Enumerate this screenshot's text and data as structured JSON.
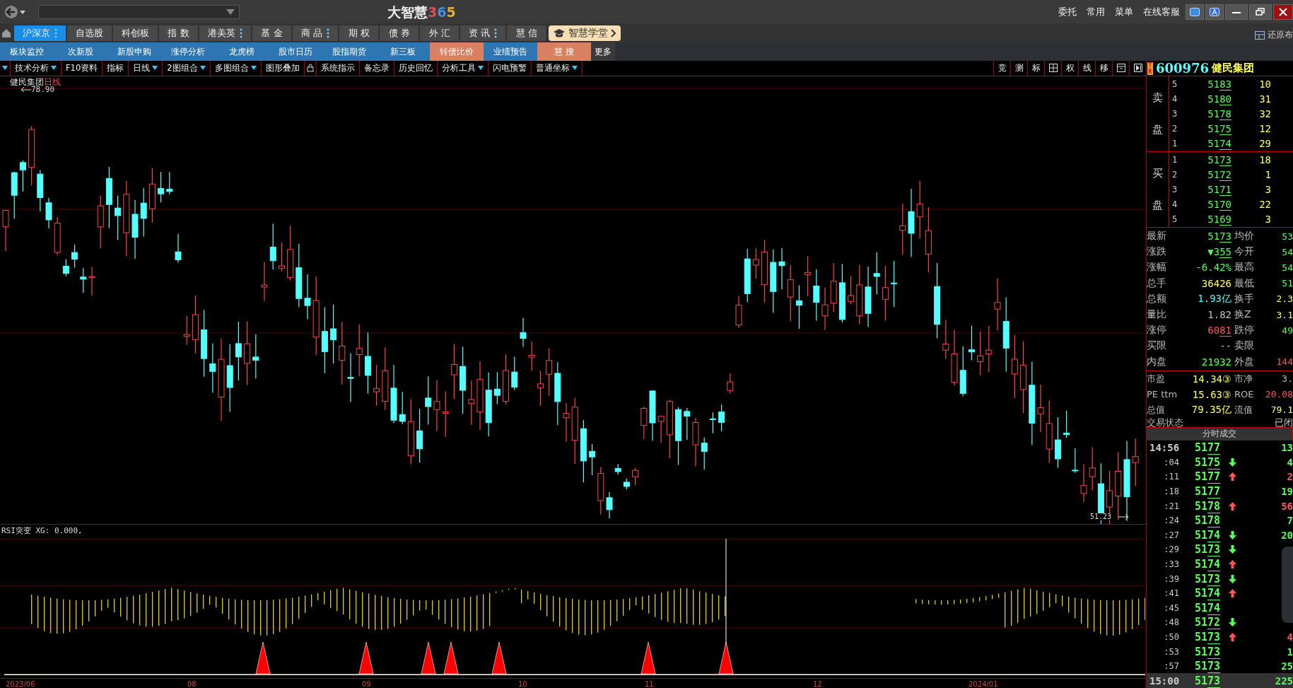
{
  "title_bar": {
    "title": "大智慧",
    "title_suffix": "365",
    "links": [
      "委托",
      "常用",
      "菜单",
      "在线客服"
    ]
  },
  "main_tabs": [
    {
      "label": "沪深京",
      "selected": true,
      "menu": true
    },
    {
      "label": "自选股",
      "selected": false,
      "menu": false
    },
    {
      "label": "科创板",
      "selected": false,
      "menu": false
    },
    {
      "label": "指 数",
      "selected": false,
      "menu": false
    },
    {
      "label": "港美英",
      "selected": false,
      "menu": true
    },
    {
      "label": "基 金",
      "selected": false,
      "menu": false
    },
    {
      "label": "商 品",
      "selected": false,
      "menu": true
    },
    {
      "label": "期 权",
      "selected": false,
      "menu": false
    },
    {
      "label": "债 券",
      "selected": false,
      "menu": false
    },
    {
      "label": "外 汇",
      "selected": false,
      "menu": false
    },
    {
      "label": "资 讯",
      "selected": false,
      "menu": true
    },
    {
      "label": "慧 信",
      "selected": false,
      "menu": false
    }
  ],
  "academy_button": "智慧学堂",
  "restore_layout": "还原布",
  "sub_tabs": [
    {
      "label": "板块监控",
      "kind": "plain"
    },
    {
      "label": "次新股",
      "kind": "plain"
    },
    {
      "label": "新股申购",
      "kind": "plain"
    },
    {
      "label": "涨停分析",
      "kind": "plain"
    },
    {
      "label": "龙虎榜",
      "kind": "plain"
    },
    {
      "label": "股市日历",
      "kind": "plain"
    },
    {
      "label": "股指期货",
      "kind": "plain"
    },
    {
      "label": "新三板",
      "kind": "plain"
    },
    {
      "label": "转债比价",
      "kind": "orange"
    },
    {
      "label": "业绩预告",
      "kind": "blue"
    },
    {
      "label": "慧 搜",
      "kind": "orange"
    },
    {
      "label": "更多",
      "kind": "dark"
    }
  ],
  "toolbar": [
    {
      "kind": "caret"
    },
    {
      "kind": "text",
      "label": "技术分析",
      "dropdown": true
    },
    {
      "kind": "text",
      "label": "F10资料",
      "dropdown": false
    },
    {
      "kind": "text",
      "label": "指标",
      "dropdown": false
    },
    {
      "kind": "text",
      "label": "日线",
      "dropdown": true
    },
    {
      "kind": "text",
      "label": "2图组合",
      "dropdown": true
    },
    {
      "kind": "text",
      "label": "多图组合",
      "dropdown": true
    },
    {
      "kind": "text",
      "label": "图形叠加",
      "dropdown": false
    },
    {
      "kind": "lock"
    },
    {
      "kind": "text",
      "label": "系统指示",
      "dropdown": false
    },
    {
      "kind": "text",
      "label": "备忘录",
      "dropdown": false
    },
    {
      "kind": "text",
      "label": "历史回忆",
      "dropdown": false
    },
    {
      "kind": "text",
      "label": "分析工具",
      "dropdown": true
    },
    {
      "kind": "text",
      "label": "闪电预警",
      "dropdown": false
    },
    {
      "kind": "text",
      "label": "普通坐标",
      "dropdown": true
    }
  ],
  "chart_tools": [
    {
      "kind": "text",
      "label": "竞"
    },
    {
      "kind": "text",
      "label": "测"
    },
    {
      "kind": "text",
      "label": "标"
    },
    {
      "kind": "grid"
    },
    {
      "kind": "text",
      "label": "权"
    },
    {
      "kind": "text",
      "label": "线"
    },
    {
      "kind": "text",
      "label": "移"
    },
    {
      "kind": "panel"
    },
    {
      "kind": "play"
    }
  ],
  "chart": {
    "name": "健民集团",
    "period": "日线",
    "high_label": "78.90",
    "low_label": "51.23",
    "x_labels": [
      "2023/06",
      "08",
      "09",
      "10",
      "11",
      "12",
      "2024/01"
    ]
  },
  "indicator": {
    "label": "RSI突变 XG: 0.000,"
  },
  "stock": {
    "badge": "TR",
    "code": "600976",
    "name": "健民集团"
  },
  "order_book": {
    "sell_label": "卖盘",
    "buy_label": "买盘",
    "sells": [
      {
        "level": "5",
        "price": "5183",
        "volume": "10"
      },
      {
        "level": "4",
        "price": "5180",
        "volume": "31"
      },
      {
        "level": "3",
        "price": "5178",
        "volume": "32"
      },
      {
        "level": "2",
        "price": "5175",
        "volume": "12"
      },
      {
        "level": "1",
        "price": "5174",
        "volume": "29"
      }
    ],
    "buys": [
      {
        "level": "1",
        "price": "5173",
        "volume": "18"
      },
      {
        "level": "2",
        "price": "5172",
        "volume": "1"
      },
      {
        "level": "3",
        "price": "5171",
        "volume": "3"
      },
      {
        "level": "4",
        "price": "5170",
        "volume": "22"
      },
      {
        "level": "5",
        "price": "5169",
        "volume": "3"
      }
    ]
  },
  "stats": [
    {
      "left": {
        "label": "最新",
        "value": "5173",
        "color": "#55ff55",
        "underline": true
      },
      "right": {
        "label": "均价",
        "value": "53",
        "color": "#55ff55"
      }
    },
    {
      "left": {
        "label": "涨跌",
        "value": "▼355",
        "color": "#55ff55",
        "underline": true
      },
      "right": {
        "label": "今开",
        "value": "54",
        "color": "#55ff55"
      }
    },
    {
      "left": {
        "label": "涨幅",
        "value": "-6.42%",
        "color": "#55ff55",
        "underline": false
      },
      "right": {
        "label": "最高",
        "value": "54",
        "color": "#55ff55"
      }
    },
    {
      "left": {
        "label": "总手",
        "value": "36426",
        "color": "#ffff55",
        "underline": false
      },
      "right": {
        "label": "最低",
        "value": "51",
        "color": "#55ff55"
      }
    },
    {
      "left": {
        "label": "总额",
        "value": "1.93亿",
        "color": "#55ffff",
        "underline": false
      },
      "right": {
        "label": "换手",
        "value": "2.3",
        "color": "#ffff55"
      }
    },
    {
      "left": {
        "label": "量比",
        "value": "1.82",
        "color": "#c0c0c0",
        "underline": false
      },
      "right": {
        "label": "换Z",
        "value": "3.1",
        "color": "#ffff55"
      }
    },
    {
      "left": {
        "label": "涨停",
        "value": "6081",
        "color": "#ff5555",
        "underline": true
      },
      "right": {
        "label": "跌停",
        "value": "49",
        "color": "#55ff55"
      }
    },
    {
      "left": {
        "label": "买限",
        "value": "--",
        "color": "#c0c0c0",
        "underline": false
      },
      "right": {
        "label": "卖限"
      }
    },
    {
      "left": {
        "label": "内盘",
        "value": "21932",
        "color": "#55ff55",
        "underline": false
      },
      "right": {
        "label": "外盘",
        "value": "144",
        "color": "#ff5555"
      }
    }
  ],
  "valuation": [
    {
      "left": {
        "label": "市盈",
        "value": "14.34③",
        "color": "#ffff55"
      },
      "right": {
        "label": "市净",
        "value": "3.",
        "color": "#c0c0c0"
      }
    },
    {
      "left": {
        "label": "PE ttm",
        "value": "15.63③",
        "color": "#ffff55"
      },
      "right": {
        "label": "ROE",
        "value": "20.08",
        "color": "#ff5555"
      }
    },
    {
      "left": {
        "label": "总值",
        "value": "79.35亿",
        "color": "#ffff55"
      },
      "right": {
        "label": "流值",
        "value": "79.1",
        "color": "#ffff55"
      }
    }
  ],
  "trade_status": {
    "label": "交易状态",
    "value": "已闭"
  },
  "trades_header": "分时成交",
  "trades": [
    {
      "time": "14:56",
      "price": "5177",
      "kind": "flat",
      "volume": "13"
    },
    {
      "time": ":04",
      "price": "5175",
      "kind": "down",
      "volume": "4"
    },
    {
      "time": ":11",
      "price": "5177",
      "kind": "up",
      "volume": "2"
    },
    {
      "time": ":18",
      "price": "5177",
      "kind": "flat",
      "volume": "19"
    },
    {
      "time": ":21",
      "price": "5178",
      "kind": "up",
      "volume": "56"
    },
    {
      "time": ":24",
      "price": "5178",
      "kind": "flat",
      "volume": "7"
    },
    {
      "time": ":27",
      "price": "5174",
      "kind": "down",
      "volume": "20"
    },
    {
      "time": ":29",
      "price": "5173",
      "kind": "down"
    },
    {
      "time": ":33",
      "price": "5174",
      "kind": "up"
    },
    {
      "time": ":39",
      "price": "5173",
      "kind": "down"
    },
    {
      "time": ":41",
      "price": "5174",
      "kind": "up"
    },
    {
      "time": ":45",
      "price": "5174",
      "kind": "flat"
    },
    {
      "time": ":48",
      "price": "5172",
      "kind": "down"
    },
    {
      "time": ":50",
      "price": "5173",
      "kind": "up",
      "volume": "4"
    },
    {
      "time": ":53",
      "price": "5173",
      "kind": "flat",
      "volume": "1"
    },
    {
      "time": ":57",
      "price": "5173",
      "kind": "flat",
      "volume": "25"
    },
    {
      "time": "15:00",
      "price": "5173",
      "kind": "flat",
      "volume": "225"
    }
  ]
}
